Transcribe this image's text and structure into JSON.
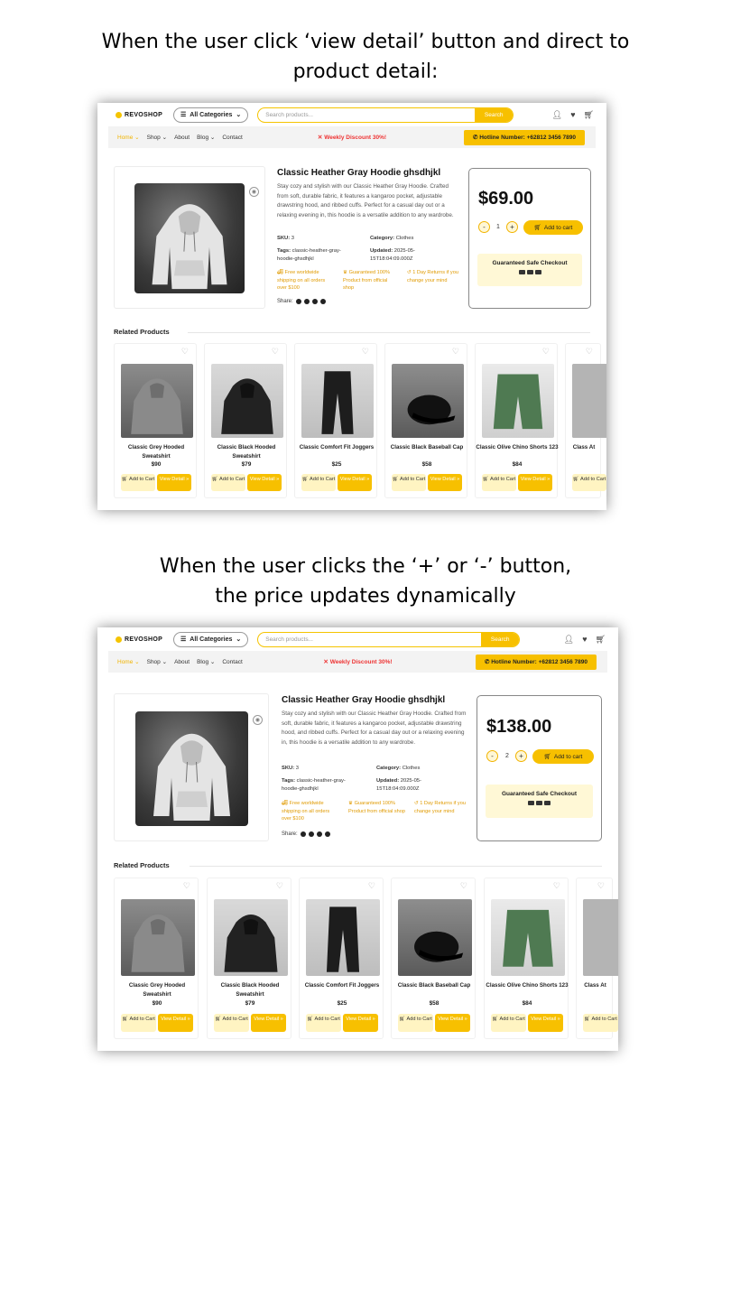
{
  "captions": {
    "top_line1": "When the user click ‘view detail’ button and direct to",
    "top_line2": "product detail:",
    "bottom_line1": "When the user clicks the ‘+’ or ‘-’ button,",
    "bottom_line2": "the price updates dynamically"
  },
  "shared": {
    "logo": "REVOSHOP",
    "categories_label": "All Categories",
    "search_placeholder": "Search products...",
    "search_button": "Search",
    "nav": [
      "Home",
      "Shop",
      "About",
      "Blog",
      "Contact"
    ],
    "promo": "Weekly Discount 30%!",
    "hotline": "Hotline Number: +62812 3456 7890",
    "product": {
      "title": "Classic Heather Gray Hoodie ghsdhjkl",
      "description": "Stay cozy and stylish with our Classic Heather Gray Hoodie. Crafted from soft, durable fabric, it features a kangaroo pocket, adjustable drawstring hood, and ribbed cuffs. Perfect for a casual day out or a relaxing evening in, this hoodie is a versatile addition to any wardrobe.",
      "sku_label": "SKU:",
      "sku": "3",
      "category_label": "Category:",
      "category": "Clothes",
      "tags_label": "Tags:",
      "tags": "classic-heather-gray-hoodie-ghsdhjkl",
      "updated_label": "Updated:",
      "updated": "2025-05-15T18:04:09.000Z",
      "features": [
        "Free worldwide shipping on all orders over $100",
        "Guaranteed 100% Product from official shop",
        "1 Day Returns if you change your mind"
      ],
      "share_label": "Share:"
    },
    "add_to_cart": "Add to cart",
    "safe_checkout": "Guaranteed Safe Checkout",
    "related_title": "Related Products",
    "related": [
      {
        "name": "Classic Grey Hooded Sweatshirt",
        "price": "$90"
      },
      {
        "name": "Classic Black Hooded Sweatshirt",
        "price": "$79"
      },
      {
        "name": "Classic Comfort Fit Joggers",
        "price": "$25"
      },
      {
        "name": "Classic Black Baseball Cap",
        "price": "$58"
      },
      {
        "name": "Classic Olive Chino Shorts 123",
        "price": "$84"
      },
      {
        "name": "Class At",
        "price": ""
      }
    ],
    "add_label": "Add to Cart",
    "view_label": "View Detail »"
  },
  "screen1": {
    "price": "$69.00",
    "qty": "1"
  },
  "screen2": {
    "price": "$138.00",
    "qty": "2"
  },
  "icons": [
    "shopping-bag-icon",
    "menu-icon",
    "user-icon",
    "heart-icon",
    "cart-icon",
    "phone-icon",
    "eye-icon",
    "facebook-icon",
    "instagram-icon",
    "tiktok-icon",
    "linkedin-icon"
  ]
}
